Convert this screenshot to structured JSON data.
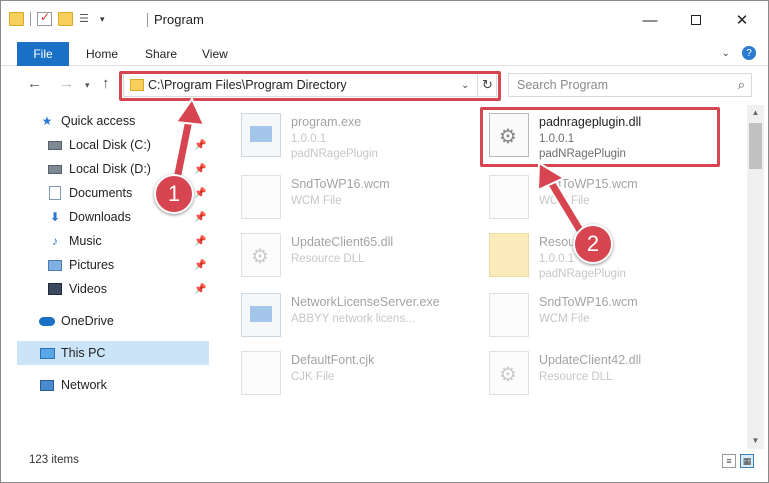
{
  "window": {
    "title": "Program",
    "minimize_icon": "minimize-icon",
    "maximize_icon": "maximize-icon",
    "close_label": "✕"
  },
  "ribbon": {
    "tabs": [
      "File",
      "Home",
      "Share",
      "View"
    ]
  },
  "navbar": {
    "address": "C:\\Program Files\\Program Directory",
    "search_placeholder": "Search Program"
  },
  "sidebar": {
    "items": [
      {
        "label": "Quick access",
        "icon": "star-icon"
      },
      {
        "label": "Local Disk (C:)",
        "icon": "disk-icon"
      },
      {
        "label": "Local Disk (D:)",
        "icon": "disk-icon"
      },
      {
        "label": "Documents",
        "icon": "documents-icon"
      },
      {
        "label": "Downloads",
        "icon": "download-icon"
      },
      {
        "label": "Music",
        "icon": "music-icon"
      },
      {
        "label": "Pictures",
        "icon": "pictures-icon"
      },
      {
        "label": "Videos",
        "icon": "videos-icon"
      },
      {
        "label": "OneDrive",
        "icon": "cloud-icon"
      },
      {
        "label": "This PC",
        "icon": "computer-icon"
      },
      {
        "label": "Network",
        "icon": "network-icon"
      }
    ]
  },
  "files": [
    {
      "name": "program.exe",
      "line2": "1.0.0.1",
      "line3": "padNRagePlugin",
      "icon": "exe-icon"
    },
    {
      "name": "padnrageplugin.dll",
      "line2": "1.0.0.1",
      "line3": "padNRagePlugin",
      "icon": "dll-icon"
    },
    {
      "name": "SndToWP16.wcm",
      "line2": "WCM File",
      "line3": "",
      "icon": "file-icon"
    },
    {
      "name": "SndToWP15.wcm",
      "line2": "WCM File",
      "line3": "",
      "icon": "file-icon"
    },
    {
      "name": "UpdateClient65.dll",
      "line2": "Resource DLL",
      "line3": "",
      "icon": "dll-icon"
    },
    {
      "name": "Resource",
      "line2": "1.0.0.1",
      "line3": "padNRagePlugin",
      "icon": "folder-icon"
    },
    {
      "name": "NetworkLicenseServer.exe",
      "line2": "ABBYY network licens...",
      "line3": "",
      "icon": "exe-icon"
    },
    {
      "name": "SndToWP16.wcm",
      "line2": "WCM File",
      "line3": "",
      "icon": "file-icon"
    },
    {
      "name": "DefaultFont.cjk",
      "line2": "CJK File",
      "line3": "",
      "icon": "file-icon"
    },
    {
      "name": "UpdateClient42.dll",
      "line2": "Resource DLL",
      "line3": "",
      "icon": "dll-icon"
    }
  ],
  "status": {
    "item_count": "123 items"
  },
  "callouts": [
    "1",
    "2"
  ],
  "colors": {
    "accent": "#1a70c4",
    "highlight_red": "#d64550",
    "selected_nav": "#cce4f7"
  }
}
